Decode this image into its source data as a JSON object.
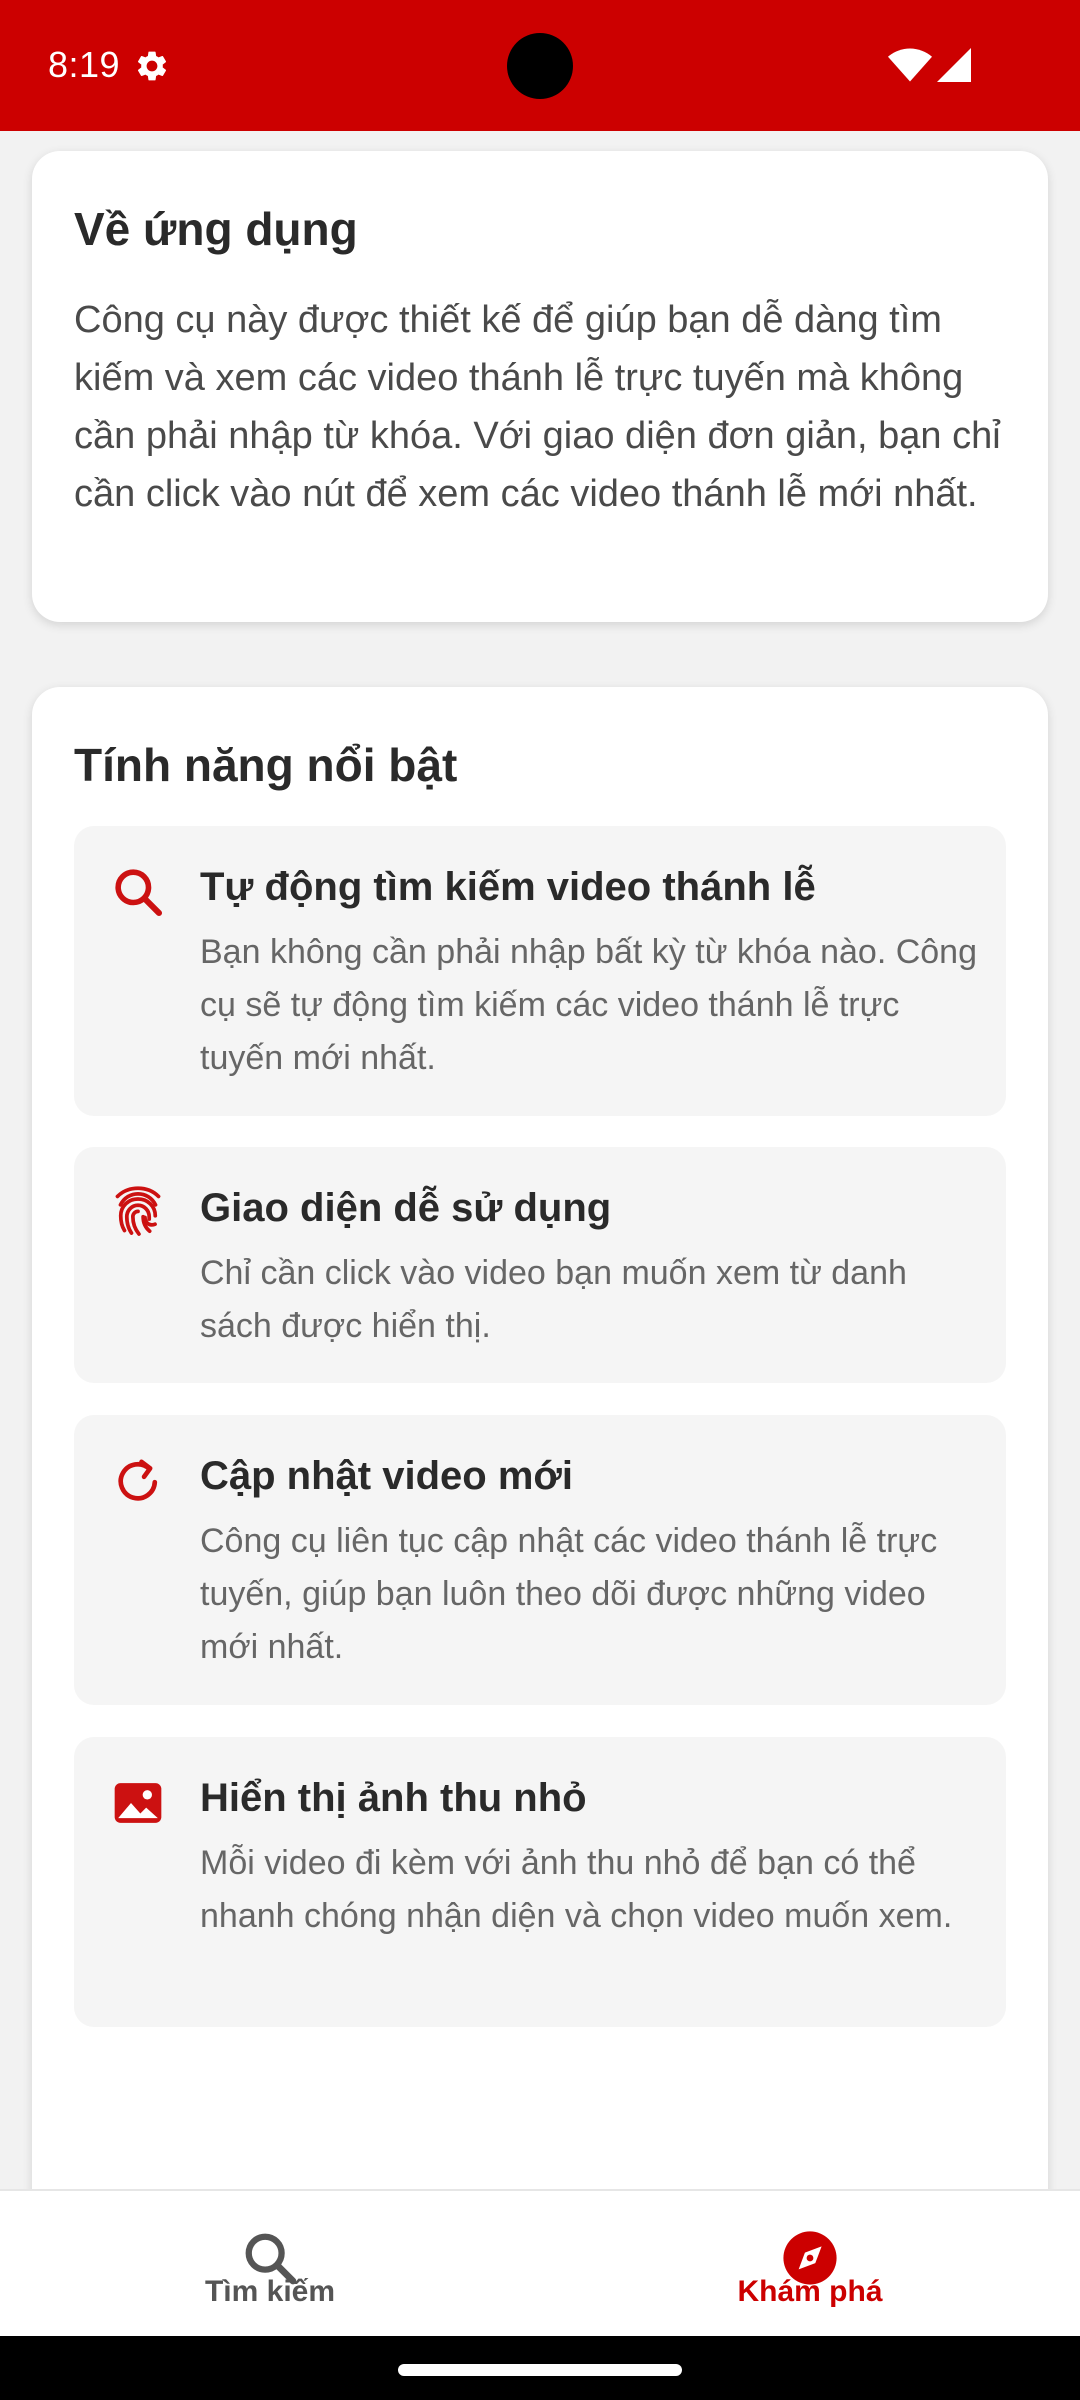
{
  "status_bar": {
    "time": "8:19",
    "icons": [
      "gear-icon",
      "camera-hole",
      "wifi-icon",
      "signal-icon"
    ],
    "color": "#cc0000"
  },
  "about": {
    "title": "Về ứng dụng",
    "text": "Công cụ này được thiết kế để giúp bạn dễ dàng tìm kiếm và xem các video thánh lễ trực tuyến mà không cần phải nhập từ khóa. Với giao diện đơn giản, bạn chỉ cần click vào nút để xem các video thánh lễ mới nhất."
  },
  "features": {
    "title": "Tính năng nổi bật",
    "items": [
      {
        "icon": "search-icon",
        "title": "Tự động tìm kiếm video thánh lễ",
        "desc": "Bạn không cần phải nhập bất kỳ từ khóa nào. Công cụ sẽ tự động tìm kiếm các video thánh lễ trực tuyến mới nhất."
      },
      {
        "icon": "fingerprint-icon",
        "title": "Giao diện dễ sử dụng",
        "desc": "Chỉ cần click vào video bạn muốn xem từ danh sách được hiển thị."
      },
      {
        "icon": "refresh-icon",
        "title": "Cập nhật video mới",
        "desc": "Công cụ liên tục cập nhật các video thánh lễ trực tuyến, giúp bạn luôn theo dõi được những video mới nhất."
      },
      {
        "icon": "image-icon",
        "title": "Hiển thị ảnh thu nhỏ",
        "desc": "Mỗi video đi kèm với ảnh thu nhỏ để bạn có thể nhanh chóng nhận diện và chọn video muốn xem."
      }
    ]
  },
  "bottom_nav": {
    "items": [
      {
        "label": "Tìm kiếm",
        "icon": "search-icon",
        "active": false
      },
      {
        "label": "Khám phá",
        "icon": "compass-icon",
        "active": true
      }
    ],
    "active_color": "#cc0000"
  }
}
